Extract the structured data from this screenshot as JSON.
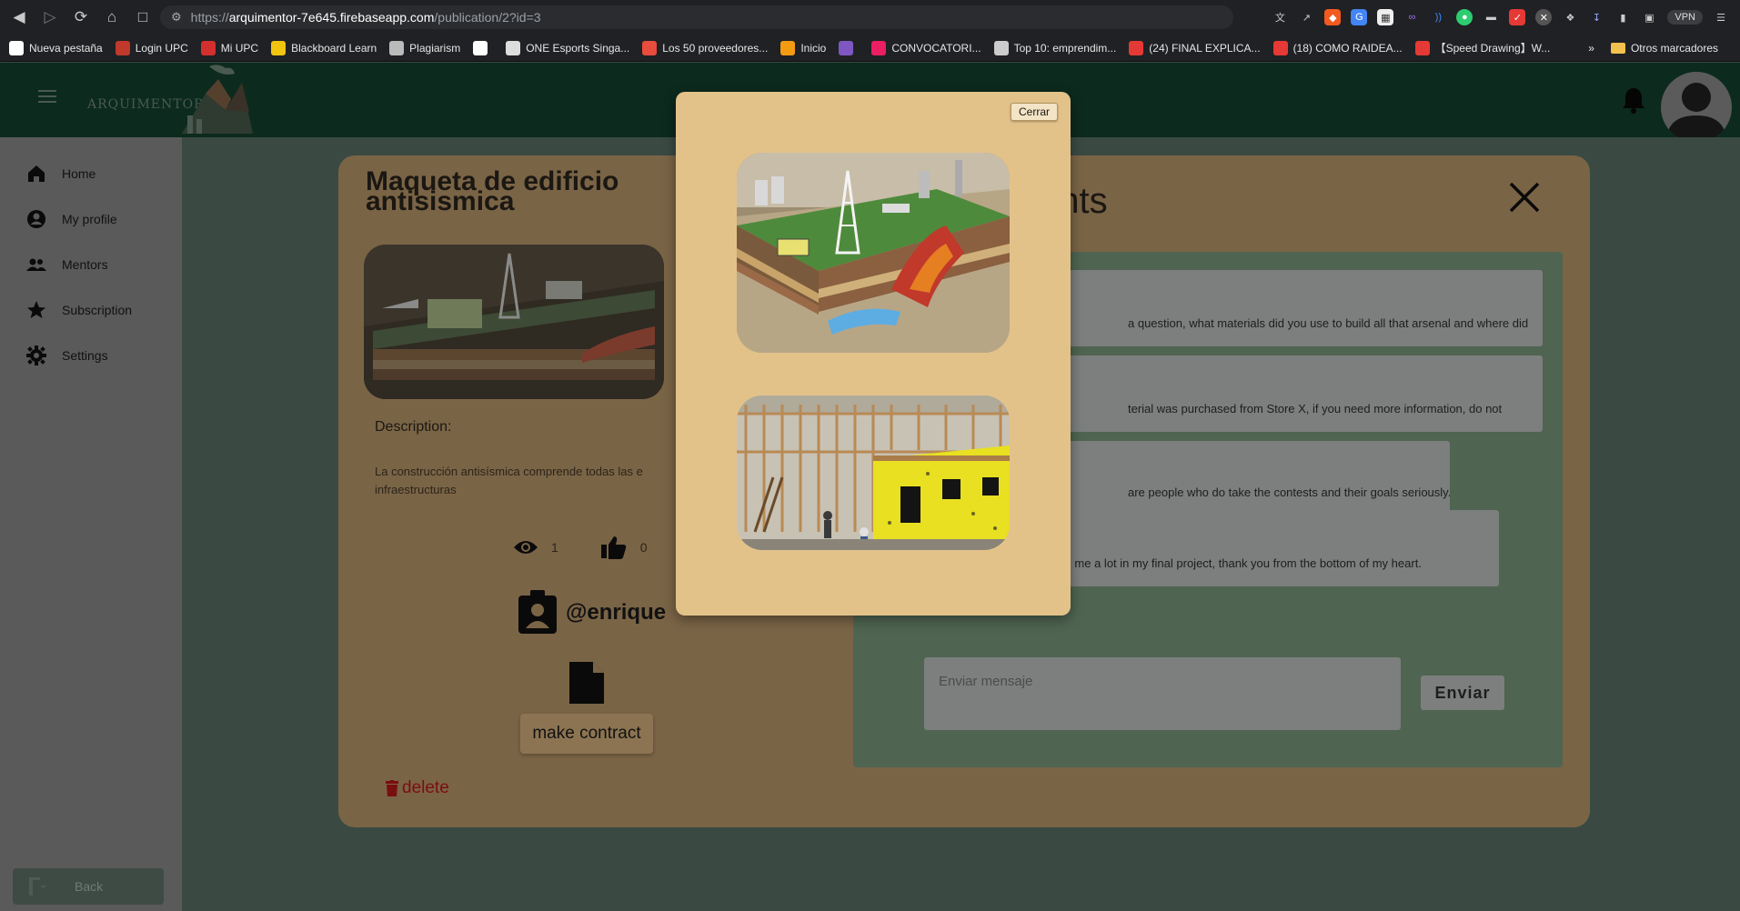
{
  "browser": {
    "url_scheme": "https://",
    "url_host": "arquimentor-7e645.firebaseapp.com",
    "url_path": "/publication/2?id=3",
    "vpn_label": "VPN",
    "bookmarks": [
      {
        "label": "Nueva pestaña",
        "color": "#ffffff"
      },
      {
        "label": "Login UPC",
        "color": "#c0392b"
      },
      {
        "label": "Mi UPC",
        "color": "#d32f2f"
      },
      {
        "label": "Blackboard Learn",
        "color": "#f1c40f"
      },
      {
        "label": "Plagiarism",
        "color": "#bbbbbb"
      },
      {
        "label": "",
        "color": "#ffffff"
      },
      {
        "label": "ONE Esports Singa...",
        "color": "#dddddd"
      },
      {
        "label": "Los 50 proveedores...",
        "color": "#e74c3c"
      },
      {
        "label": "Inicio",
        "color": "#f39c12"
      },
      {
        "label": "",
        "color": "#7e57c2"
      },
      {
        "label": "CONVOCATORI...",
        "color": "#e91e63"
      },
      {
        "label": "Top 10: emprendim...",
        "color": "#cccccc"
      },
      {
        "label": "(24) FINAL EXPLICA...",
        "color": "#e53935"
      },
      {
        "label": "(18) COMO RAIDEA...",
        "color": "#e53935"
      },
      {
        "label": "【Speed Drawing】W...",
        "color": "#e53935"
      }
    ],
    "more_label": "»",
    "other_bookmarks": "Otros marcadores"
  },
  "header": {
    "brand": "ARQUIMENTOR"
  },
  "sidebar": {
    "items": [
      {
        "label": "Home",
        "icon": "home-icon"
      },
      {
        "label": "My profile",
        "icon": "account-circle-icon"
      },
      {
        "label": "Mentors",
        "icon": "people-icon"
      },
      {
        "label": "Subscription",
        "icon": "star-icon"
      },
      {
        "label": "Settings",
        "icon": "gear-icon"
      }
    ],
    "back_label": "Back"
  },
  "publication": {
    "title_line1": "Maqueta de edificio",
    "title_line2": "antisismica",
    "description_label": "Description:",
    "description_line1": "La construcción antisísmica comprende todas las e",
    "description_line2": "infraestructuras",
    "views": "1",
    "likes": "0",
    "author": "@enrique",
    "contract_label": "make contract",
    "delete_label": "delete"
  },
  "comments": {
    "title_visible": "ents",
    "items": [
      {
        "text": "a question, what materials did you use to build all that arsenal and where did"
      },
      {
        "text": "terial was purchased from Store X, if you need more information, do not"
      },
      {
        "text": "are people who do take the contests and their goals seriously."
      },
      {
        "text": "Incredible work, it helped me a lot in my final project, thank you from the bottom of my heart."
      }
    ],
    "input_placeholder": "Enviar mensaje",
    "send_label": "Enviar"
  },
  "modal": {
    "close_label": "Cerrar"
  }
}
